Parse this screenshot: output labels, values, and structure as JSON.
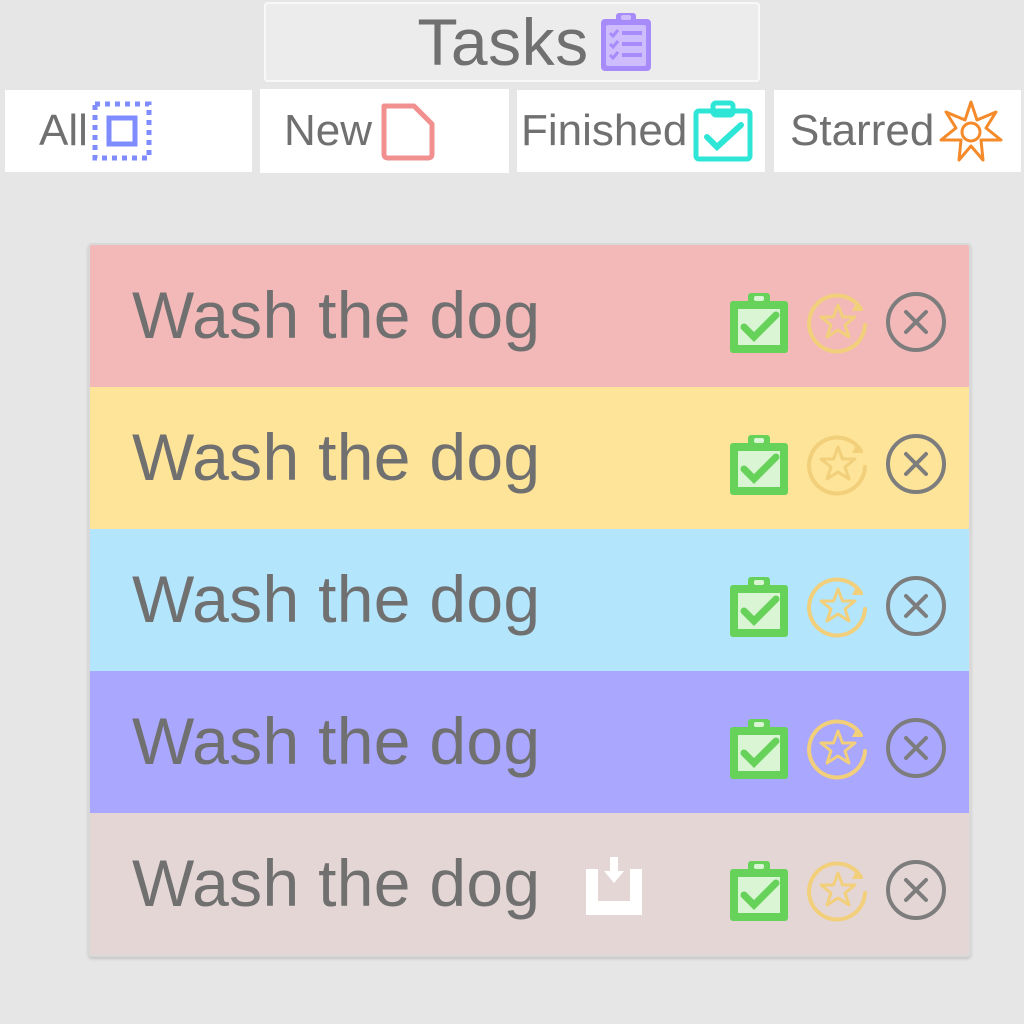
{
  "header": {
    "title": "Tasks",
    "title_icon": "clipboard-checklist-icon",
    "title_icon_color": "#a78bfa"
  },
  "tabs": [
    {
      "label": "All",
      "icon": "select-all-icon",
      "color": "#7f8cff"
    },
    {
      "label": "New",
      "icon": "new-document-icon",
      "color": "#f28f8f"
    },
    {
      "label": "Finished",
      "icon": "clipboard-check-icon",
      "color": "#2ee6d6"
    },
    {
      "label": "Starred",
      "icon": "starburst-icon",
      "color": "#f58a2a"
    }
  ],
  "tasks": [
    {
      "text": "Wash the dog",
      "color": "#f3b9b9",
      "saving": false
    },
    {
      "text": "Wash the dog",
      "color": "#fde498",
      "saving": false
    },
    {
      "text": "Wash the dog",
      "color": "#b3e5fc",
      "saving": false
    },
    {
      "text": "Wash the dog",
      "color": "#aaa7ff",
      "saving": false
    },
    {
      "text": "Wash the dog",
      "color": "#e5d6d6",
      "saving": true
    }
  ],
  "actions": {
    "finish_icon": "clipboard-check-icon",
    "finish_color": "#66d25a",
    "star_icon": "circled-star-icon",
    "star_color": "#f2cf7a",
    "delete_icon": "circled-x-icon",
    "delete_color": "#7d7d7d",
    "save_icon": "save-tray-icon"
  }
}
